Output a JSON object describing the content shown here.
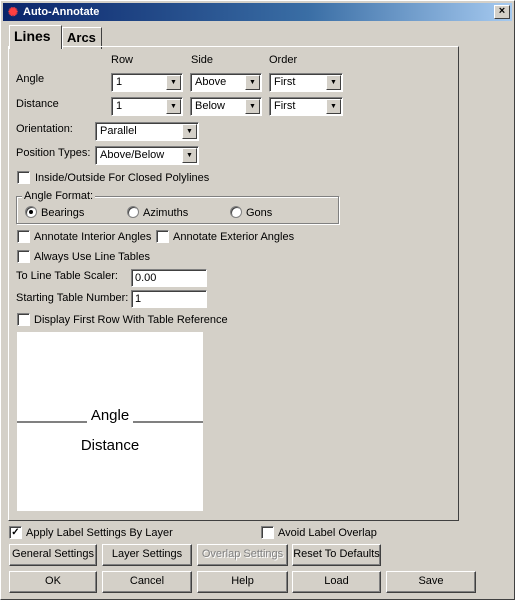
{
  "window": {
    "title": "Auto-Annotate",
    "close_label": "×"
  },
  "tabs": [
    {
      "label": "Lines",
      "active": true
    },
    {
      "label": "Arcs",
      "active": false
    }
  ],
  "columns": {
    "row": "Row",
    "side": "Side",
    "order": "Order"
  },
  "angle": {
    "label": "Angle",
    "row": "1",
    "side": "Above",
    "order": "First"
  },
  "distance": {
    "label": "Distance",
    "row": "1",
    "side": "Below",
    "order": "First"
  },
  "orientation": {
    "label": "Orientation:",
    "value": "Parallel"
  },
  "position_types": {
    "label": "Position Types:",
    "value": "Above/Below"
  },
  "inside_outside": {
    "label": "Inside/Outside For Closed Polylines",
    "checked": false
  },
  "angle_format": {
    "title": "Angle Format:",
    "options": [
      {
        "label": "Bearings",
        "selected": true
      },
      {
        "label": "Azimuths",
        "selected": false
      },
      {
        "label": "Gons",
        "selected": false
      }
    ]
  },
  "interior_angles": {
    "label": "Annotate Interior Angles",
    "checked": false
  },
  "exterior_angles": {
    "label": "Annotate Exterior Angles",
    "checked": false
  },
  "always_line_tables": {
    "label": "Always Use Line Tables",
    "checked": false
  },
  "table_scaler": {
    "label": "To Line Table Scaler:",
    "value": "0.00"
  },
  "starting_number": {
    "label": "Starting Table Number:",
    "value": "1"
  },
  "first_row_ref": {
    "label": "Display First Row With Table Reference",
    "checked": false
  },
  "preview": {
    "angle_text": "Angle",
    "distance_text": "Distance"
  },
  "apply_by_layer": {
    "label": "Apply Label Settings By Layer",
    "checked": true
  },
  "avoid_overlap": {
    "label": "Avoid Label Overlap",
    "checked": false
  },
  "buttons": {
    "general": "General Settings",
    "layer": "Layer Settings",
    "overlap": "Overlap Settings",
    "reset": "Reset To Defaults",
    "ok": "OK",
    "cancel": "Cancel",
    "help": "Help",
    "load": "Load",
    "save": "Save"
  }
}
